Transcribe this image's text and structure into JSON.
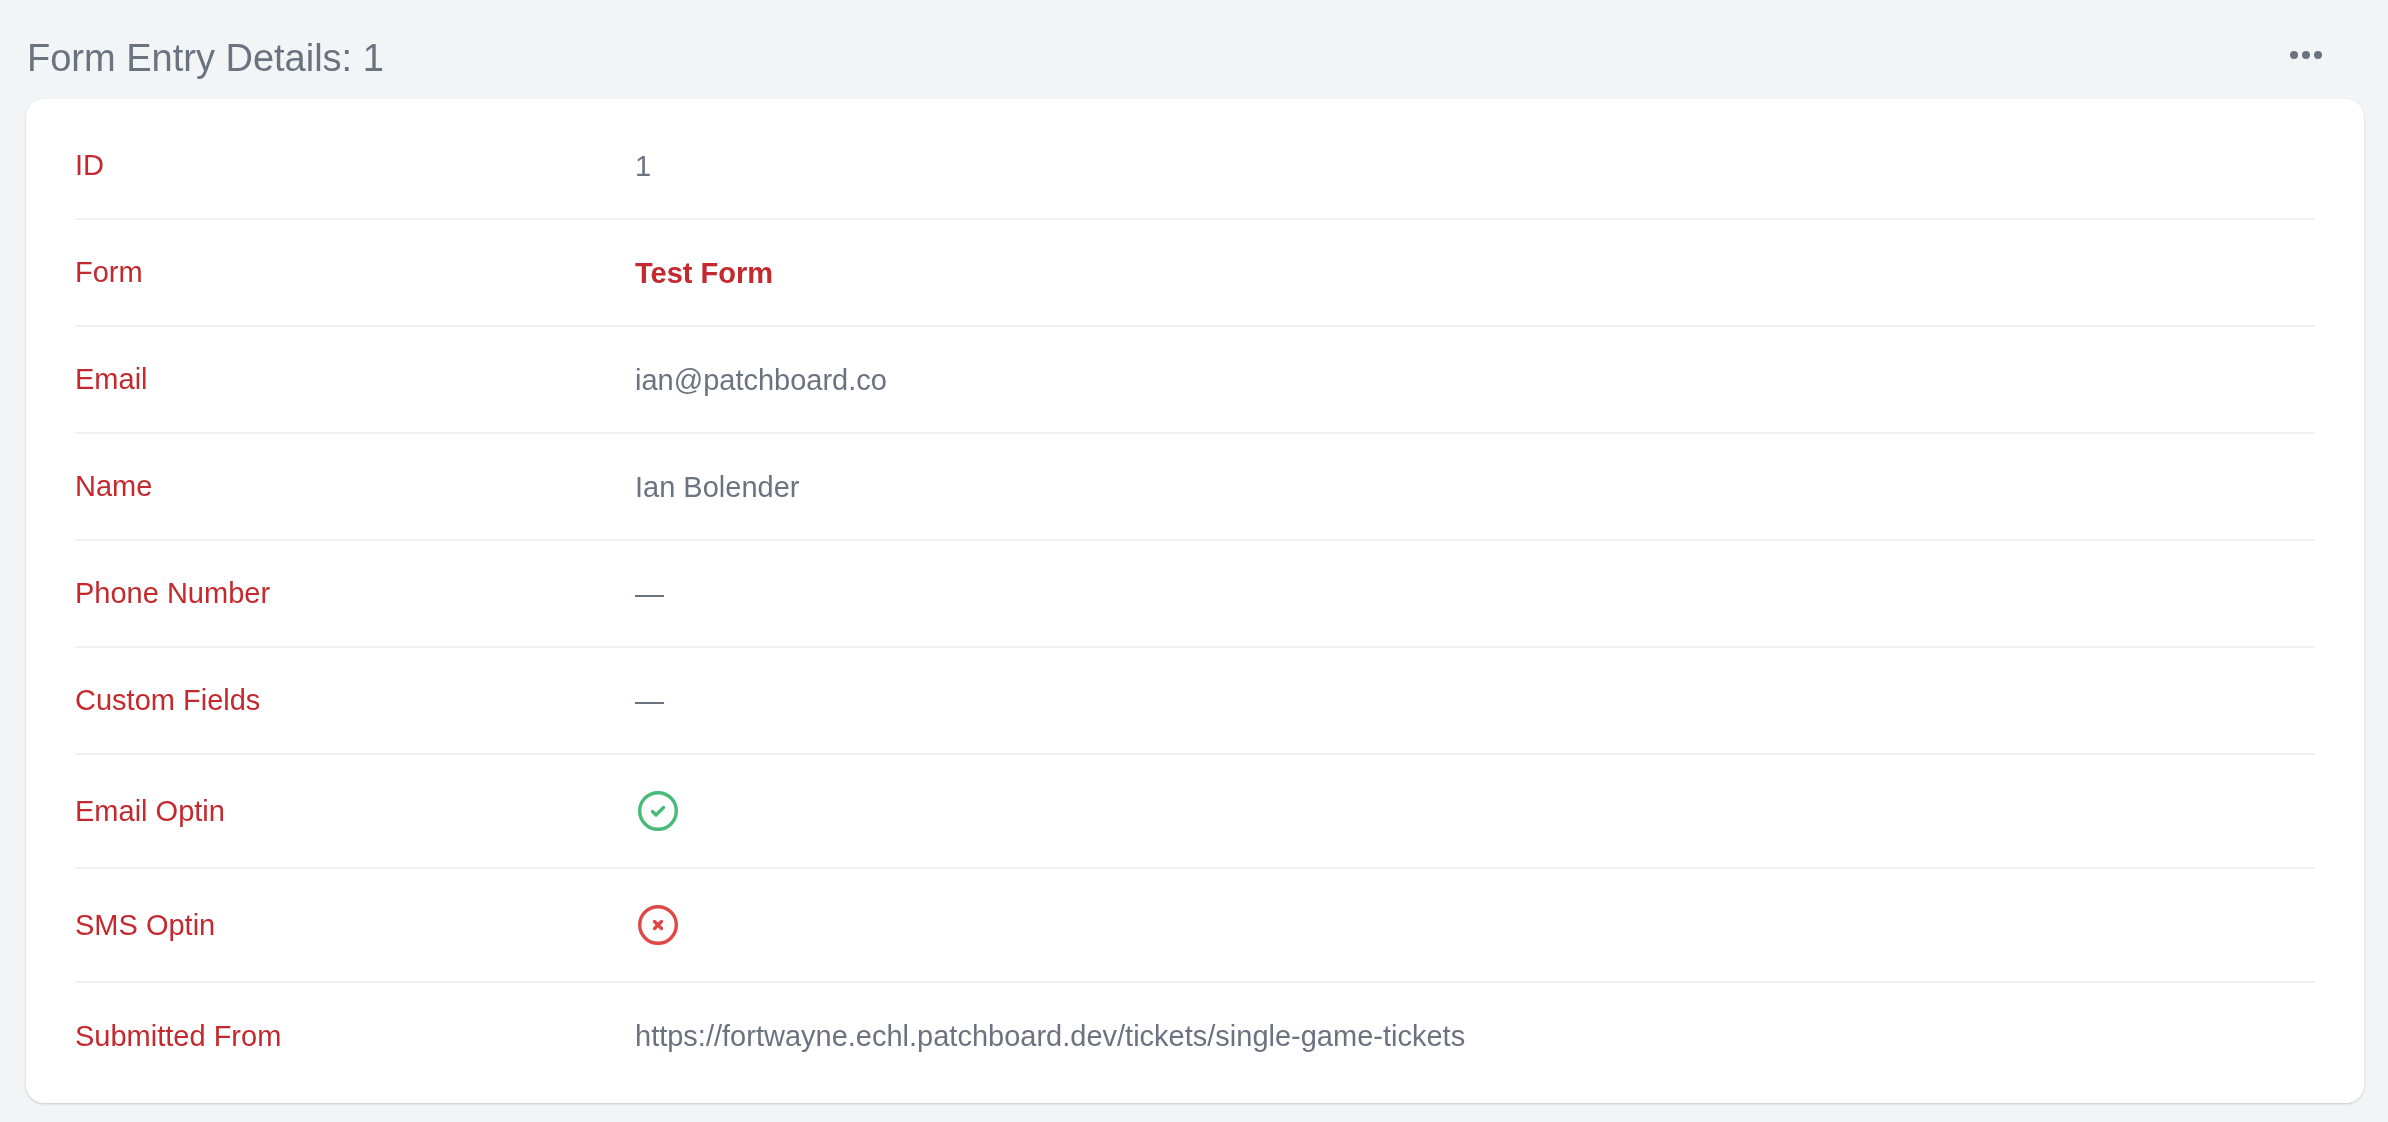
{
  "page": {
    "title": "Form Entry Details: 1"
  },
  "details": [
    {
      "label": "ID",
      "kind": "text",
      "value": "1"
    },
    {
      "label": "Form",
      "kind": "link",
      "value": "Test Form"
    },
    {
      "label": "Email",
      "kind": "text",
      "value": "ian@patchboard.co"
    },
    {
      "label": "Name",
      "kind": "text",
      "value": "Ian Bolender"
    },
    {
      "label": "Phone Number",
      "kind": "text",
      "value": "—"
    },
    {
      "label": "Custom Fields",
      "kind": "text",
      "value": "—"
    },
    {
      "label": "Email Optin",
      "kind": "boolean",
      "checked": true
    },
    {
      "label": "SMS Optin",
      "kind": "boolean",
      "checked": false
    },
    {
      "label": "Submitted From",
      "kind": "text",
      "value": "https://fortwayne.echl.patchboard.dev/tickets/single-game-tickets"
    }
  ]
}
